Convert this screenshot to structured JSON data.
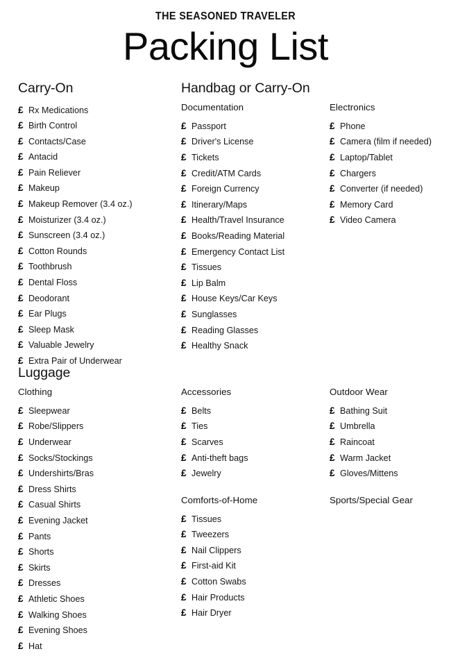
{
  "document": {
    "kicker": "THE SEASONED TRAVELER",
    "title": "Packing List",
    "marker_glyph": "£",
    "marker_icon_name": "checkbox-icon",
    "ink_color": "#111111",
    "background_color": "#ffffff"
  },
  "sections": [
    {
      "heading": "Carry-On",
      "columns": [
        {
          "groups": [
            {
              "title": "",
              "items": [
                "Rx Medications",
                "Birth Control",
                "Contacts/Case",
                "Antacid",
                "Pain Reliever",
                "Makeup",
                "Makeup Remover (3.4 oz.)",
                "Moisturizer (3.4 oz.)",
                "Sunscreen (3.4 oz.)",
                "Cotton Rounds",
                "Toothbrush",
                "Dental Floss",
                "Deodorant",
                "Ear Plugs",
                "Sleep Mask",
                "Valuable Jewelry",
                "Extra Pair of Underwear"
              ]
            }
          ]
        }
      ]
    },
    {
      "heading": "Handbag or Carry-On",
      "columns": [
        {
          "groups": [
            {
              "title": "Documentation",
              "items": [
                "Passport",
                "Driver's License",
                "Tickets",
                "Credit/ATM Cards",
                "Foreign Currency",
                "Itinerary/Maps",
                "Health/Travel Insurance",
                "Books/Reading Material",
                "Emergency Contact List",
                "Tissues",
                "Lip Balm",
                "House Keys/Car Keys",
                "Sunglasses",
                "Reading Glasses",
                "Healthy Snack"
              ]
            }
          ]
        },
        {
          "groups": [
            {
              "title": "Electronics",
              "items": [
                "Phone",
                "Camera (film if needed)",
                "Laptop/Tablet",
                "Chargers",
                "Converter (if needed)",
                "Memory Card",
                "Video Camera"
              ]
            }
          ]
        }
      ]
    },
    {
      "heading": "Luggage",
      "columns": [
        {
          "groups": [
            {
              "title": "Clothing",
              "items": [
                "Sleepwear",
                "Robe/Slippers",
                "Underwear",
                "Socks/Stockings",
                "Undershirts/Bras",
                "Dress Shirts",
                "Casual Shirts",
                "Evening Jacket",
                "Pants",
                "Shorts",
                "Skirts",
                "Dresses",
                "Athletic Shoes",
                "Walking Shoes",
                "Evening Shoes",
                "Hat"
              ]
            }
          ]
        },
        {
          "groups": [
            {
              "title": "Accessories",
              "items": [
                "Belts",
                "Ties",
                "Scarves",
                "Anti-theft bags",
                "Jewelry"
              ]
            },
            {
              "title": "Comforts-of-Home",
              "items": [
                "Tissues",
                "Tweezers",
                "Nail Clippers",
                "First-aid Kit",
                "Cotton Swabs",
                "Hair Products",
                "Hair Dryer"
              ]
            }
          ]
        },
        {
          "groups": [
            {
              "title": "Outdoor Wear",
              "items": [
                "Bathing Suit",
                "Umbrella",
                "Raincoat",
                "Warm Jacket",
                "Gloves/Mittens"
              ]
            },
            {
              "title": "Sports/Special Gear",
              "items": []
            }
          ]
        }
      ]
    }
  ]
}
